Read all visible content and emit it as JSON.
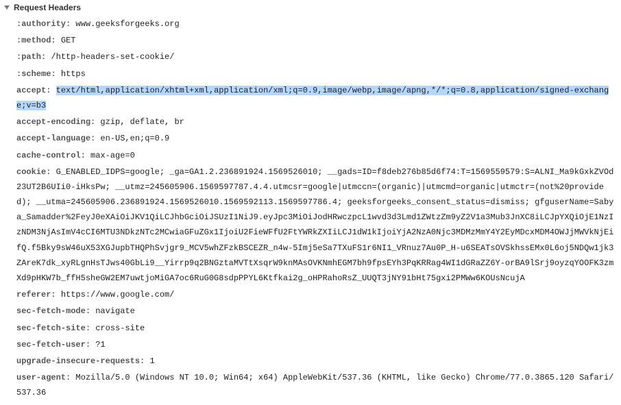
{
  "section": {
    "title": "Request Headers"
  },
  "headers": [
    {
      "name": ":authority:",
      "value": "www.geeksforgeeks.org",
      "highlighted": false
    },
    {
      "name": ":method:",
      "value": "GET",
      "highlighted": false
    },
    {
      "name": ":path:",
      "value": "/http-headers-set-cookie/",
      "highlighted": false
    },
    {
      "name": ":scheme:",
      "value": "https",
      "highlighted": false
    },
    {
      "name": "accept:",
      "value": "text/html,application/xhtml+xml,application/xml;q=0.9,image/webp,image/apng,*/*;q=0.8,application/signed-exchange;v=b3",
      "highlighted": true
    },
    {
      "name": "accept-encoding:",
      "value": "gzip, deflate, br",
      "highlighted": false
    },
    {
      "name": "accept-language:",
      "value": "en-US,en;q=0.9",
      "highlighted": false
    },
    {
      "name": "cache-control:",
      "value": "max-age=0",
      "highlighted": false
    },
    {
      "name": "cookie:",
      "value": "G_ENABLED_IDPS=google; _ga=GA1.2.236891924.1569526010; __gads=ID=f8deb276b85d6f74:T=1569559579:S=ALNI_Ma9kGxkZVOd23UT2B6UIi0-iHksPw; __utmz=245605906.1569597787.4.4.utmcsr=google|utmccn=(organic)|utmcmd=organic|utmctr=(not%20provided); __utma=245605906.236891924.1569526010.1569592113.1569597786.4; geeksforgeeks_consent_status=dismiss; gfguserName=Sabya_Samadder%2FeyJ0eXAiOiJKV1QiLCJhbGciOiJSUzI1NiJ9.eyJpc3MiOiJodHRwczpcL1wvd3d3Lmd1ZWtzZm9yZ2V1a3Mub3JnXC8iLCJpYXQiOjE1NzIzNDM3NjAsImV4cCI6MTU3NDkzNTc2MCwiaGFuZGx1IjoiU2FieWFfU2FtYWRkZXIiLCJ1dW1kIjoiYjA2NzA0Njc3MDMzMmY4Y2EyMDcxMDM4OWJjMWVkNjEifQ.f5Bky9sW46uX53XGJupbTHQPhSvjgr9_MCV5whZFzkBSCEZR_n4w-5Imj5eSa7TXuFS1r6NI1_VRnuz7Au0P_H-u6SEATsOVSkhssEMx0L6oj5NDQw1jk3ZAreK7dk_xyRLgnHsTJws40GbLi9__Yirrp9q2BNGztaMVTtXsqrW9knMAsOVKNmhEGM7bh9fpsEYh3PqKRRag4WI1dGRaZZ6Y-orBA9lSrj9oyzqYOOFK3zmXd9pHKW7b_ffH5sheGW2EM7uwtjoMiGA7oc6RuG0G8sdpPPYL6Ktfkai2g_oHPRahoRsZ_UUQT3jNY91bHt75gxi2PMWw6KOUsNcujA",
      "highlighted": false
    },
    {
      "name": "referer:",
      "value": "https://www.google.com/",
      "highlighted": false
    },
    {
      "name": "sec-fetch-mode:",
      "value": "navigate",
      "highlighted": false
    },
    {
      "name": "sec-fetch-site:",
      "value": "cross-site",
      "highlighted": false
    },
    {
      "name": "sec-fetch-user:",
      "value": "?1",
      "highlighted": false
    },
    {
      "name": "upgrade-insecure-requests:",
      "value": "1",
      "highlighted": false
    },
    {
      "name": "user-agent:",
      "value": "Mozilla/5.0 (Windows NT 10.0; Win64; x64) AppleWebKit/537.36 (KHTML, like Gecko) Chrome/77.0.3865.120 Safari/537.36",
      "highlighted": false
    }
  ]
}
